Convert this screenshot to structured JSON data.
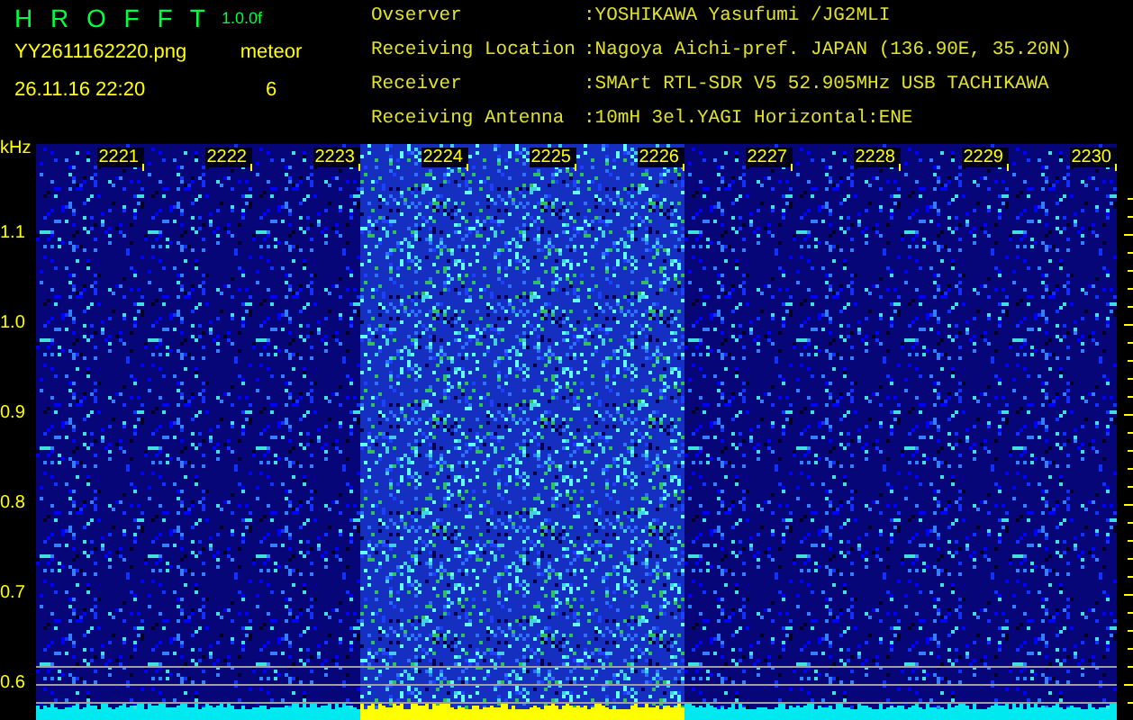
{
  "header": {
    "app_name": "H R O F F T",
    "version": "1.0.0f",
    "filename": "YY2611162220.png",
    "timestamp": "26.11.16 22:20",
    "event_type": "meteor",
    "event_count": "6"
  },
  "station_info": [
    {
      "label": "Ovserver",
      "value": ":YOSHIKAWA Yasufumi /JG2MLI"
    },
    {
      "label": "Receiving Location",
      "value": ":Nagoya Aichi-pref. JAPAN (136.90E, 35.20N)"
    },
    {
      "label": "Receiver",
      "value": ":SMArt RTL-SDR V5 52.905MHz USB TACHIKAWA"
    },
    {
      "label": "Receiving Antenna",
      "value": ":10mH 3el.YAGI Horizontal:ENE"
    }
  ],
  "spectrogram": {
    "y_unit": "kHz",
    "y_ticks": [
      "1.1",
      "1.0",
      "0.9",
      "0.8",
      "0.7",
      "0.6"
    ],
    "minutes": [
      {
        "label": "2221",
        "signal": false
      },
      {
        "label": "2222",
        "signal": false
      },
      {
        "label": "2223",
        "signal": false
      },
      {
        "label": "2224",
        "signal": true
      },
      {
        "label": "2225",
        "signal": true
      },
      {
        "label": "2226",
        "signal": true
      },
      {
        "label": "2227",
        "signal": false
      },
      {
        "label": "2228",
        "signal": false
      },
      {
        "label": "2229",
        "signal": false
      },
      {
        "label": "2230",
        "signal": false
      }
    ]
  }
}
